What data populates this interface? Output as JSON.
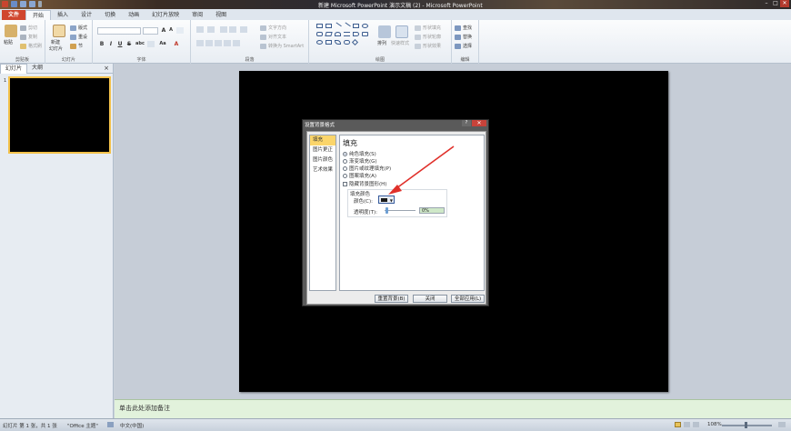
{
  "window": {
    "title": "新建 Microsoft PowerPoint 演示文稿 (2) - Microsoft PowerPoint",
    "controls": [
      "–",
      "□",
      "✕"
    ]
  },
  "ribbon_tabs": [
    "文件",
    "开始",
    "插入",
    "设计",
    "切换",
    "动画",
    "幻灯片放映",
    "审阅",
    "视图"
  ],
  "ribbon": {
    "clipboard": {
      "title": "剪贴板",
      "paste": "粘贴",
      "cut": "剪切",
      "copy": "复制",
      "format_painter": "格式刷"
    },
    "slides": {
      "title": "幻灯片",
      "new_slide": "新建",
      "new_slide2": "幻灯片",
      "layout": "版式",
      "reset": "重设",
      "section": "节"
    },
    "font": {
      "title": "字体",
      "bold": "B",
      "italic": "I",
      "underline": "U",
      "strike": "S",
      "shadow": "abc",
      "grow": "A",
      "shrink": "A",
      "case": "Aa"
    },
    "paragraph": {
      "title": "段落",
      "text_direction": "文字方向",
      "align_text": "对齐文本",
      "smartart": "转换为 SmartArt"
    },
    "drawing": {
      "title": "绘图",
      "arrange": "排列",
      "quick_styles": "快速样式",
      "shape_fill": "形状填充",
      "shape_outline": "形状轮廓",
      "shape_effects": "形状效果"
    },
    "editing": {
      "title": "编辑",
      "find": "查找",
      "replace": "替换",
      "select": "选择"
    }
  },
  "left_panel": {
    "tabs": [
      "幻灯片",
      "大纲"
    ],
    "close": "×",
    "slide_number": "1"
  },
  "notes_placeholder": "单击此处添加备注",
  "status": {
    "slide": "幻灯片 第 1 张，共 1 张",
    "theme": "\"Office 主题\"",
    "language": "中文(中国)",
    "zoom": "108%"
  },
  "dialog": {
    "title": "设置背景格式",
    "help": "?",
    "close": "✕",
    "nav": [
      "填充",
      "图片更正",
      "图片颜色",
      "艺术效果"
    ],
    "heading": "填充",
    "options": [
      "纯色填充(S)",
      "渐变填充(G)",
      "图片或纹理填充(P)",
      "图案填充(A)"
    ],
    "hide_graphics": "隐藏背景图形(H)",
    "fill_color_title": "填充颜色",
    "color_label": "颜色(C):",
    "transparency_label": "透明度(T):",
    "transparency_value": "0%",
    "buttons": {
      "reset": "重置背景(B)",
      "close": "关闭",
      "apply_all": "全部应用(L)"
    }
  }
}
